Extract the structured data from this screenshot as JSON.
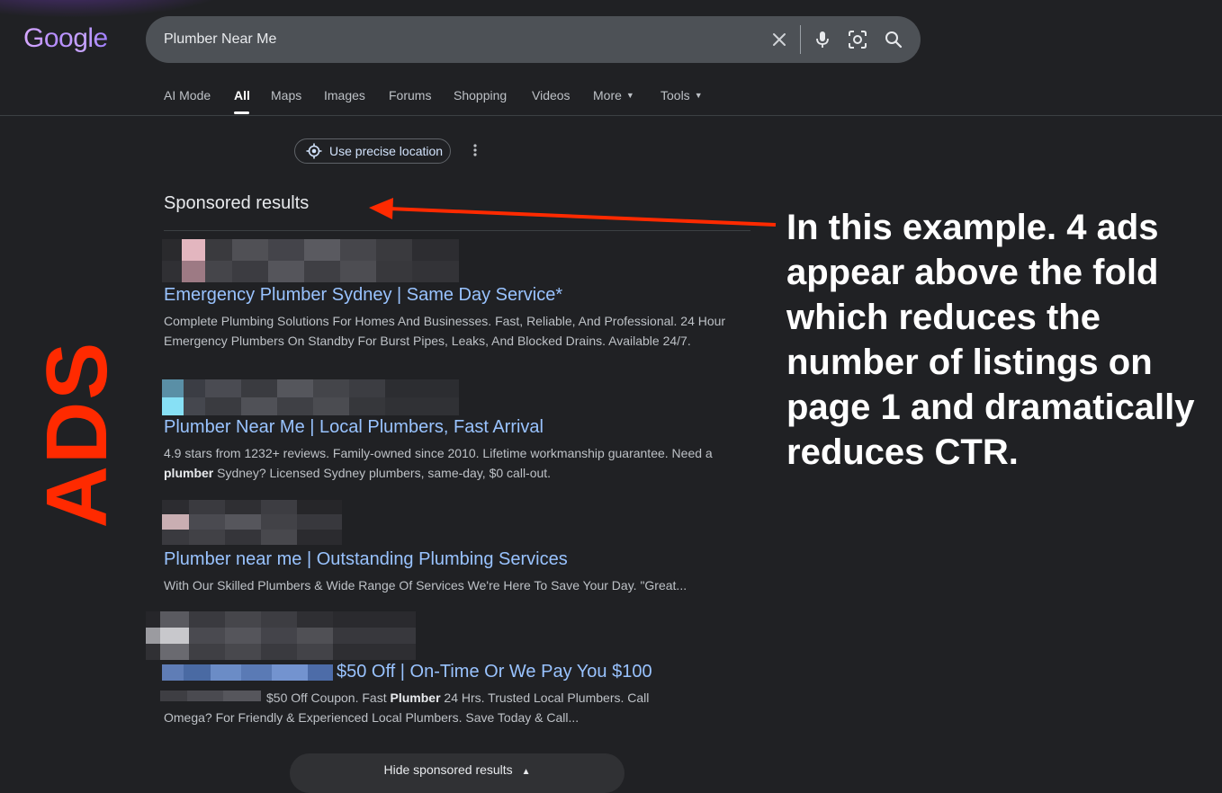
{
  "logo": {
    "text": "Google"
  },
  "search": {
    "query": "Plumber Near Me",
    "icons": [
      "close-icon",
      "microphone-icon",
      "lens-icon",
      "search-icon"
    ]
  },
  "tabs": [
    {
      "label": "AI Mode"
    },
    {
      "label": "All",
      "active": true
    },
    {
      "label": "Maps"
    },
    {
      "label": "Images"
    },
    {
      "label": "Forums"
    },
    {
      "label": "Shopping"
    },
    {
      "label": "Videos"
    },
    {
      "label": "More"
    },
    {
      "label": "Tools"
    }
  ],
  "location": {
    "label": "Use precise location"
  },
  "sponsored": {
    "title": "Sponsored results",
    "ads": [
      {
        "title": "Emergency Plumber Sydney | Same Day Service*",
        "desc_line1": "Complete Plumbing Solutions For Homes And Businesses. Fast, Reliable, And Professional. 24 Hour",
        "desc_line2": "Emergency Plumbers On Standby For Burst Pipes, Leaks, And Blocked Drains. Available 24/7."
      },
      {
        "title": "Plumber Near Me | Local Plumbers, Fast Arrival",
        "desc_pre": "4.9 stars from 1232+ reviews. Family-owned since 2010. Lifetime workmanship guarantee. Need a",
        "desc_bold": "plumber",
        "desc_post": " Sydney? Licensed Sydney plumbers, same-day, $0 call-out."
      },
      {
        "title": "Plumber near me | Outstanding Plumbing Services",
        "desc_line1": "With Our Skilled Plumbers & Wide Range Of Services We're Here To Save Your Day. \"Great..."
      },
      {
        "title": "$50 Off | On-Time Or We Pay You $100",
        "desc_pre": "$50 Off Coupon. Fast ",
        "desc_bold": "Plumber",
        "desc_post": " 24 Hrs. Trusted Local Plumbers. Call",
        "desc_line2": "Omega? For Friendly & Experienced Local Plumbers. Save Today & Call..."
      }
    ],
    "hide_label": "Hide sponsored results"
  },
  "annotations": {
    "side_label": "ADS",
    "callout_lines": [
      "In this example. 4  ads",
      "appear above the fold",
      "which reduces the",
      "number of listings on",
      "page 1 and dramatically",
      "reduces CTR."
    ],
    "accent_color": "#ff2a00"
  }
}
